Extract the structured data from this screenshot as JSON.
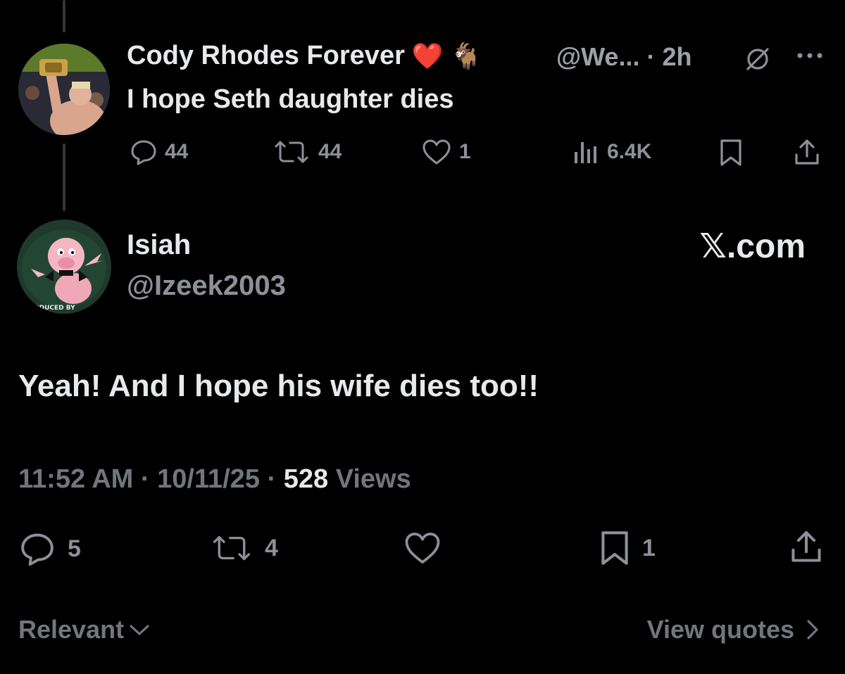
{
  "parent_tweet": {
    "display_name": "Cody Rhodes Forever",
    "name_emojis": [
      "❤️",
      "🐐"
    ],
    "handle_time": "@We... · 2h",
    "text": "I hope Seth daughter dies",
    "stats": {
      "replies": "44",
      "reposts": "44",
      "likes": "1",
      "views": "6.4K"
    }
  },
  "reply_tweet": {
    "display_name": "Isiah",
    "handle": "@Izeek2003",
    "brand": "𝕏.com",
    "text": "Yeah! And I hope his wife dies too!!",
    "time": "11:52 AM",
    "date": "10/11/25",
    "separator": "·",
    "views_count": "528",
    "views_label": "Views",
    "stats": {
      "replies": "5",
      "reposts": "4",
      "bookmarks": "1"
    }
  },
  "footer": {
    "sort_label": "Relevant",
    "view_quotes_label": "View quotes"
  },
  "icons": {
    "reply": "reply-icon",
    "repost": "repost-icon",
    "like": "heart-icon",
    "views": "analytics-icon",
    "bookmark": "bookmark-icon",
    "share": "share-icon",
    "grok": "grok-icon",
    "more": "more-icon"
  },
  "colors": {
    "background": "#000000",
    "primary_text": "#e7e9ea",
    "secondary_text": "#71767b",
    "icon_gray": "#8b9196"
  }
}
